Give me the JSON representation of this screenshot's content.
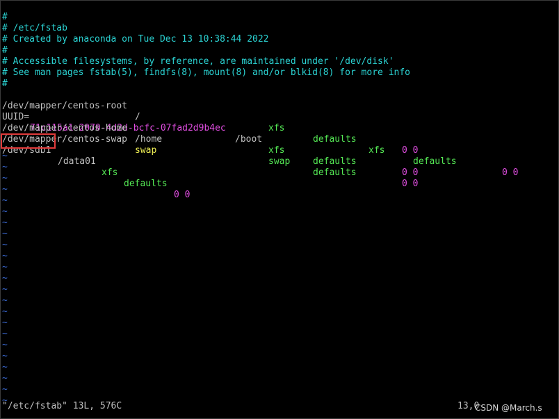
{
  "editor": {
    "header_lines": [
      "#",
      "# /etc/fstab",
      "# Created by anaconda on Tue Dec 13 10:38:44 2022",
      "#",
      "# Accessible filesystems, by reference, are maintained under '/dev/disk'",
      "# See man pages fstab(5), findfs(8), mount(8) and/or blkid(8) for more info",
      "#"
    ],
    "entries": [
      {
        "device": "/dev/mapper/centos-root",
        "mount": "/",
        "fstype": "xfs",
        "options": "defaults",
        "dump_pass": "0 0"
      },
      {
        "device_key": "UUID=",
        "device_val": "71c115a1-2070-4d2d-bcfc-07fad2d9b4ec",
        "mount": "/boot",
        "fstype": "xfs",
        "options": "defaults",
        "dump_pass": "0 0"
      },
      {
        "device": "/dev/mapper/centos-home",
        "mount": "/home",
        "fstype": "xfs",
        "options": "defaults",
        "dump_pass": "0 0"
      },
      {
        "device": "/dev/mapper/centos-swap",
        "mount": "swap",
        "fstype": "swap",
        "options": "defaults",
        "dump_pass": "0 0"
      },
      {
        "device": "/dev/sdb1",
        "mount": "/data01",
        "fstype": "xfs",
        "options": "defaults",
        "dump_pass": "0 0"
      }
    ],
    "empty_line_marker": "~",
    "empty_line_count": 23
  },
  "status_bar": {
    "file_info": "\"/etc/fstab\" 13L, 576C",
    "cursor_position": "13,0"
  },
  "watermark": "CSDN @March.s",
  "colors": {
    "comment": "#2bd2d2",
    "uuid_value": "#e14ee1",
    "fstype": "#55e955",
    "dump_pass": "#e14ee1",
    "swap_mount": "#f0f055",
    "tilde": "#3b6bd6",
    "highlight_box": "#e23b3b"
  }
}
